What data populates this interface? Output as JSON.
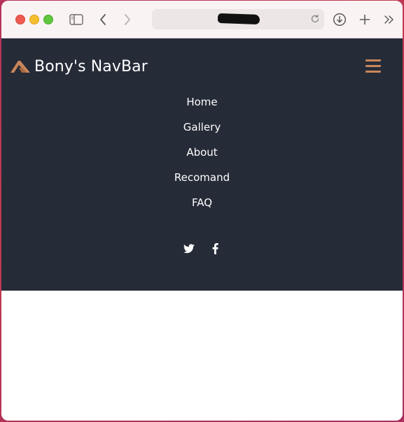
{
  "browser": {
    "icons": {
      "sidebar": "sidebar-icon",
      "back": "chevron-left-icon",
      "forward": "chevron-right-icon",
      "reload": "reload-icon",
      "download": "download-icon",
      "new_tab": "plus-icon",
      "more": "double-chevron-right-icon"
    }
  },
  "navbar": {
    "brand": "Bony's NavBar",
    "accent_color": "#c9865a",
    "background_color": "#262b38",
    "menu": [
      {
        "label": "Home"
      },
      {
        "label": "Gallery"
      },
      {
        "label": "About"
      },
      {
        "label": "Recomand"
      },
      {
        "label": "FAQ"
      }
    ],
    "social": [
      "twitter-icon",
      "facebook-icon"
    ]
  }
}
